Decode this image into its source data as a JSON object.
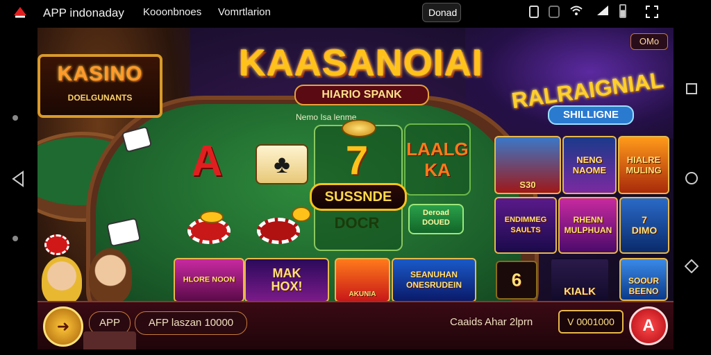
{
  "status_bar": {
    "app_title": "APP indonaday",
    "tab1": "Kooonbnoes",
    "tab2": "Vomrtlarion",
    "center_chip": "Donad",
    "icons": [
      "phone-icon",
      "record-icon",
      "wifi-icon",
      "signal-icon",
      "battery-icon",
      "fullscreen-icon"
    ]
  },
  "colors": {
    "accent": "#ffc21a",
    "felt": "#1b5e2a",
    "table_rim": "#7a4423",
    "bottom_bar": "#3a0a14"
  },
  "kasino_logo": {
    "title": "KASINO",
    "subtitle": "DOELGUNANTS"
  },
  "header": {
    "title": "KAASANOIAI",
    "subtitle": "HIARIO SPANK"
  },
  "promo_badge": "OMo",
  "right_logo": {
    "title": "RALRAIGNIAL",
    "sub": "SHILLIGNE"
  },
  "felt_label": "Nemo Isa lenme",
  "cards": [
    {
      "label": "A"
    },
    {
      "label": "♣"
    },
    {
      "label": "7"
    },
    {
      "label": "LAALG\nKA"
    }
  ],
  "slot_buttons": {
    "main": "SUSSNDE",
    "doc": "DOCR",
    "green": "Deroad\nDOUED",
    "small": "S30"
  },
  "side_tiles": [
    {
      "label": "S30"
    },
    {
      "label": "NENG\nNAOME"
    },
    {
      "label": "HIALRE\nMULING"
    },
    {
      "label": "ENDIMMEG\nSAULTS"
    },
    {
      "label": "RHENN\nMULPHUAN"
    },
    {
      "label": "7\nDIMO"
    }
  ],
  "bottom_tiles": [
    {
      "label": "HLORE NOON"
    },
    {
      "label": "MAK\nHOX!"
    },
    {
      "label": "AKUNIA"
    },
    {
      "label": "SEANUHAN\nONESRUDEIN"
    },
    {
      "label": "6"
    },
    {
      "label": "KIALK"
    },
    {
      "label": "SOOUR\nBEENO"
    }
  ],
  "bottom_bar": {
    "app_label": "APP",
    "pill_text": "AFP laszan 10000",
    "center_text": "Caaids Ahar 2lprn",
    "gold_value": "V 0001000",
    "red_button": "A",
    "app_icon": "arrow-right-icon"
  },
  "nav": {
    "right": [
      "square-icon",
      "circle-icon",
      "back-icon"
    ],
    "left": [
      "dot-icon",
      "back-triangle-icon",
      "dot-icon"
    ]
  }
}
